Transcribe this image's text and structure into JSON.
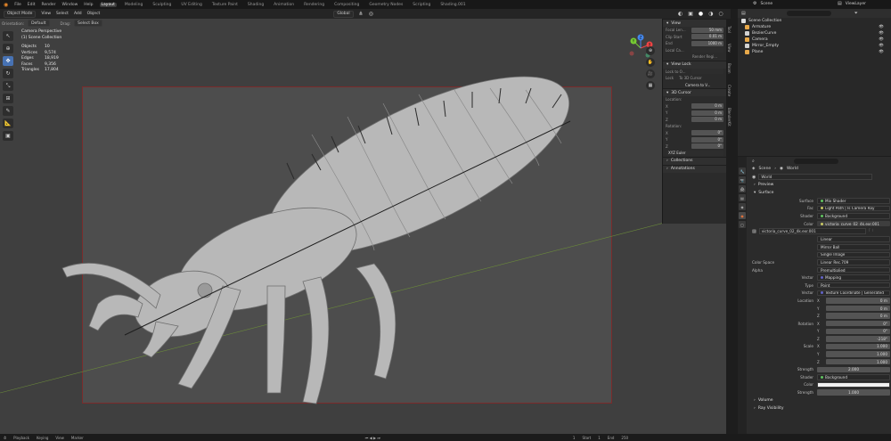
{
  "topbar": {
    "menus": [
      "File",
      "Edit",
      "Render",
      "Window",
      "Help"
    ],
    "workspaces": [
      "Layout",
      "Modeling",
      "Sculpting",
      "UV Editing",
      "Texture Paint",
      "Shading",
      "Animation",
      "Rendering",
      "Compositing",
      "Geometry Nodes",
      "Scripting",
      "Shading.001"
    ],
    "active_workspace": "Layout",
    "scene": "Scene",
    "view_layer": "ViewLayer"
  },
  "viewport_header": {
    "mode": "Object Mode",
    "menus": [
      "View",
      "Select",
      "Add",
      "Object"
    ],
    "orientation_label": "Orientation:",
    "orientation": "Default",
    "drag_label": "Drag:",
    "drag": "Select Box",
    "transform": "Global",
    "options": "Options"
  },
  "stats": {
    "view_name": "Camera Perspective",
    "collection": "(1) Scene Collection",
    "rows": [
      {
        "k": "Objects",
        "v": "10"
      },
      {
        "k": "Vertices",
        "v": "9,574"
      },
      {
        "k": "Edges",
        "v": "18,919"
      },
      {
        "k": "Faces",
        "v": "9,356"
      },
      {
        "k": "Triangles",
        "v": "17,804"
      }
    ]
  },
  "gizmo": {
    "x": "X",
    "y": "Y",
    "z": "Z"
  },
  "npanel": {
    "view_title": "View",
    "focal_label": "Focal Len...",
    "focal": "50 mm",
    "clip_start_label": "Clip Start",
    "clip_start": "0.01 m",
    "end_label": "End",
    "end": "1000 m",
    "local_camera_label": "Local Ca...",
    "render_region": "Render Regi...",
    "viewlock_title": "View Lock",
    "lock_to_obj_label": "Lock to O...",
    "lock_label": "Lock",
    "to_3d_cursor": "To 3D Cursor",
    "camera_to_view": "Camera to V...",
    "cursor_title": "3D Cursor",
    "location_label": "Location:",
    "rotation_label": "Rotation:",
    "loc": [
      {
        "a": "X",
        "v": "0 m"
      },
      {
        "a": "Y",
        "v": "0 m"
      },
      {
        "a": "Z",
        "v": "0 m"
      }
    ],
    "rot": [
      {
        "a": "X",
        "v": "0°"
      },
      {
        "a": "Y",
        "v": "0°"
      },
      {
        "a": "Z",
        "v": "0°"
      }
    ],
    "euler": "XYZ Euler",
    "collections": "Collections",
    "annotations": "Annotations"
  },
  "vtabs": [
    "Tool",
    "View",
    "Boom",
    "Create",
    "BlenderKit"
  ],
  "outliner": {
    "title": "Scene Collection",
    "items": [
      {
        "name": "Armature",
        "color": "#e8a94a"
      },
      {
        "name": "BezierCurve",
        "color": "#d2d2d2"
      },
      {
        "name": "Camera",
        "color": "#e8a94a"
      },
      {
        "name": "Mirror_Empty",
        "color": "#d2d2d2"
      },
      {
        "name": "Plane",
        "color": "#e8a94a"
      }
    ]
  },
  "props": {
    "breadcrumb_scene": "Scene",
    "breadcrumb_world": "World",
    "world_name": "World",
    "preview": "Preview",
    "surface_section": "Surface",
    "surface": "Mix Shader",
    "fac": "Light Path | Is Camera Ray",
    "shader1": "Background",
    "color": "victoria_curve_02_4k.exr.001",
    "image_name": "victoria_curve_02_4k.exr.001",
    "interp": "Linear",
    "projection": "Mirror Ball",
    "source": "Single Image",
    "color_space_label": "Color Space",
    "color_space": "Linear Rec.709",
    "alpha_label": "Alpha",
    "alpha": "Premultiplied",
    "vector_label": "Vector",
    "vector": "Mapping",
    "type_label": "Type",
    "type": "Point",
    "vector2": "Texture Coordinate | Generated",
    "location_label": "Location",
    "loc": [
      "0 m",
      "0 m",
      "0 m"
    ],
    "rotation_label": "Rotation",
    "rot": [
      "0°",
      "0°",
      "-218°"
    ],
    "scale_label": "Scale",
    "scale": [
      "1.000",
      "1.000",
      "1.000"
    ],
    "strength_label": "Strength",
    "strength": "2.000",
    "shader2_label": "Shader",
    "shader2": "Background",
    "color2_label": "Color",
    "strength2": "1.000",
    "volume": "Volume",
    "ray_visibility": "Ray Visibility"
  },
  "bottom": {
    "playback": "Playback",
    "keying": "Keying",
    "view": "View",
    "marker": "Marker",
    "frame": "1",
    "start_label": "Start",
    "start": "1",
    "end_label": "End",
    "end": "250"
  }
}
